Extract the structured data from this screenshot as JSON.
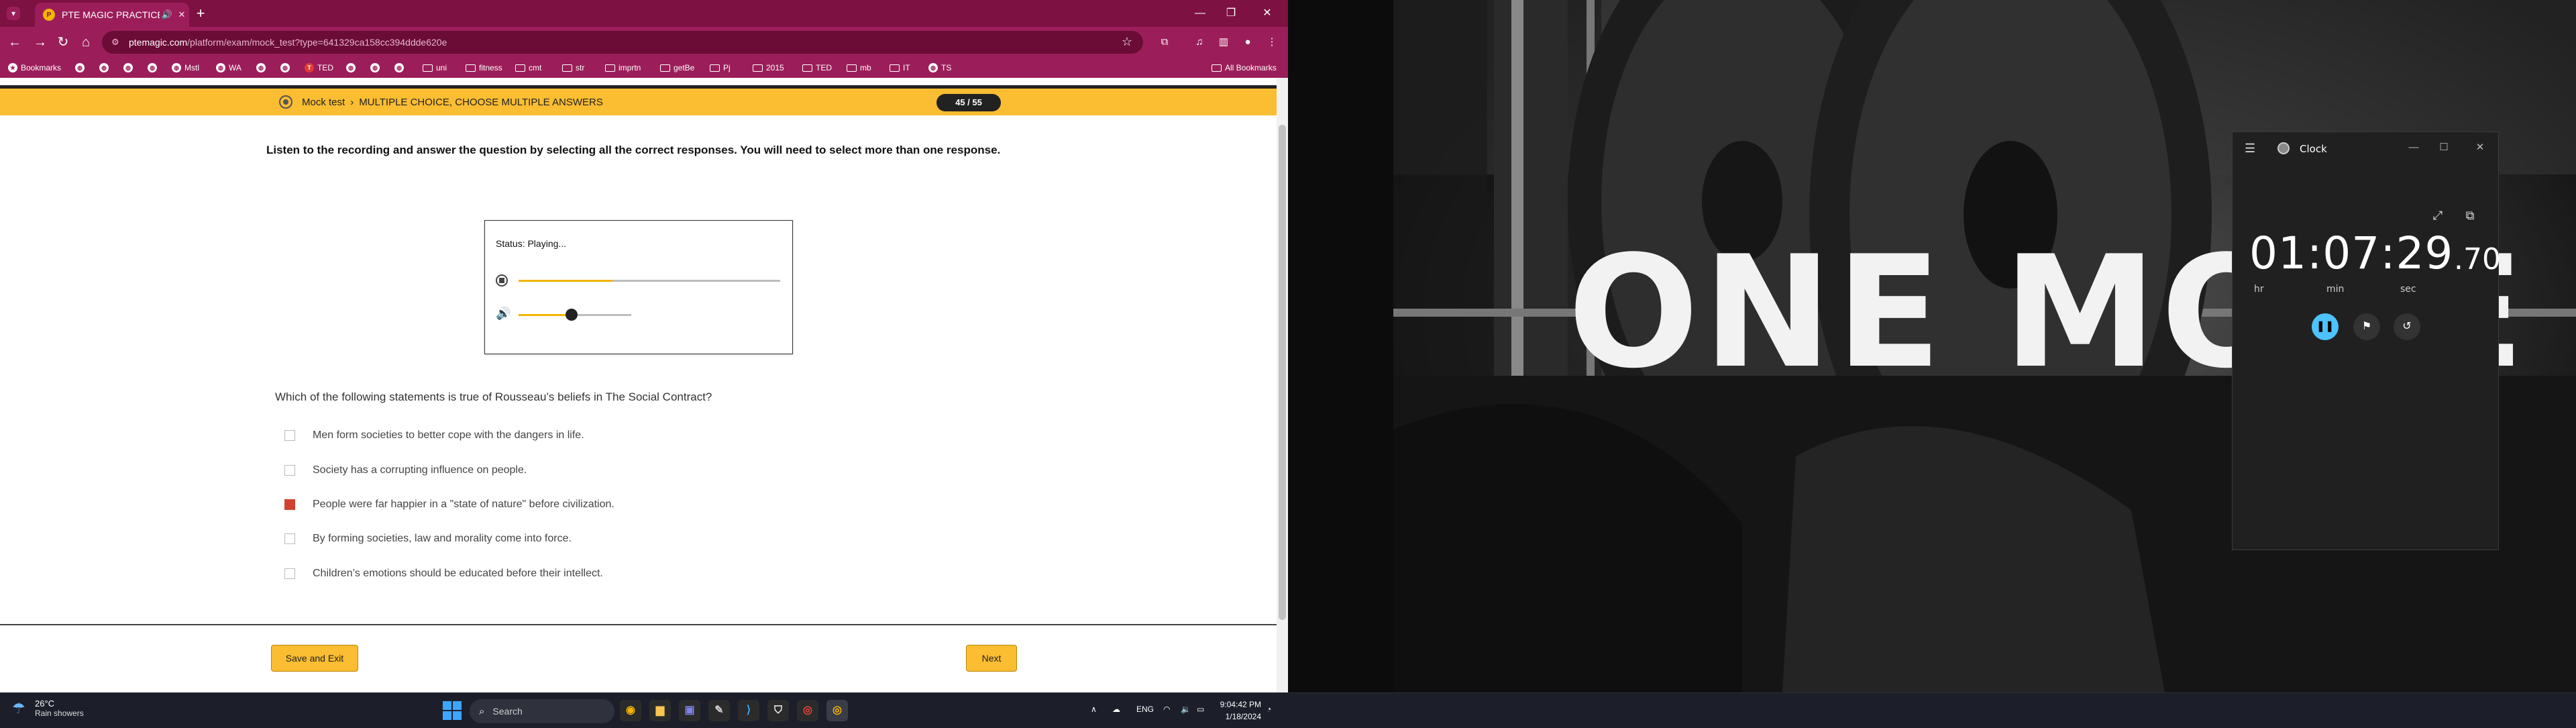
{
  "browser": {
    "tab_title": "PTE MAGIC PRACTICE",
    "url_host": "ptemagic.com",
    "url_path": "/platform/exam/mock_test?type=641329ca158cc394ddde620e",
    "bookmarks_label": "Bookmarks",
    "all_bookmarks_label": "All Bookmarks",
    "bookmarks": [
      "Mstl",
      "WA",
      "TED",
      "uni",
      "fitness",
      "cmt",
      "str",
      "imprtn",
      "getBe",
      "Pj",
      "2015",
      "TED",
      "mb",
      "IT",
      "TS"
    ]
  },
  "exam": {
    "crumb_section": "Mock test",
    "crumb_task": "MULTIPLE CHOICE, CHOOSE MULTIPLE ANSWERS",
    "counter": "45 / 55",
    "instruction": "Listen to the recording and answer the question by selecting all the correct responses. You will need to select more than one response.",
    "audio_status": "Status: Playing...",
    "audio_progress_fraction": 0.36,
    "volume_fraction": 0.47,
    "question": "Which of the following statements is true of Rousseau’s beliefs in The Social Contract?",
    "options": [
      {
        "text": "Men form societies to better cope with the dangers in life.",
        "checked": false
      },
      {
        "text": "Society has a corrupting influence on people.",
        "checked": false
      },
      {
        "text": "People were far happier in a \"state of nature\" before civilization.",
        "checked": true
      },
      {
        "text": "By forming societies, law and morality come into force.",
        "checked": false
      },
      {
        "text": "Children’s emotions should be educated before their intellect.",
        "checked": false
      }
    ],
    "save_exit_label": "Save and Exit",
    "next_label": "Next"
  },
  "wallpaper": {
    "text": "ONE MORE"
  },
  "clock_app": {
    "title": "Clock",
    "time_main": "01:07:29",
    "time_fraction": ".70",
    "unit_hr": "hr",
    "unit_min": "min",
    "unit_sec": "sec"
  },
  "taskbar": {
    "temperature": "26°C",
    "weather": "Rain showers",
    "search_placeholder": "Search",
    "language": "ENG",
    "time": "9:04:42 PM",
    "date": "1/18/2024"
  },
  "colors": {
    "chrome_accent": "#9b1e5a",
    "exam_yellow": "#fbbd31",
    "checked_red": "#d0432f",
    "clock_accent": "#4cc2ff"
  }
}
